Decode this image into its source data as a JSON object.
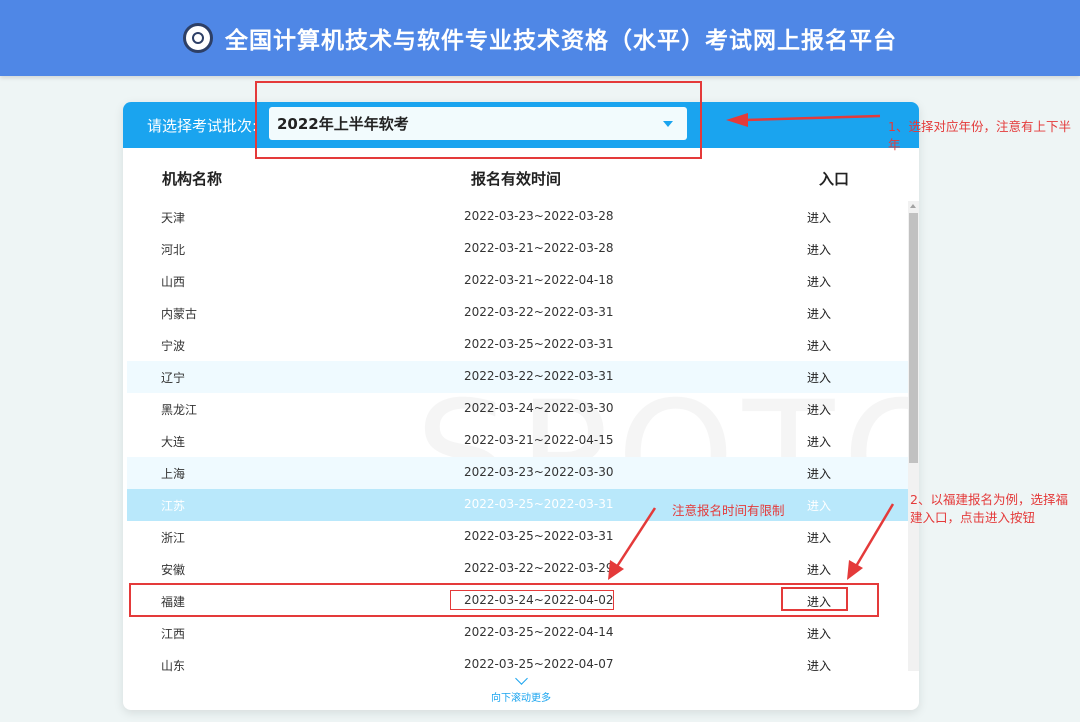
{
  "header": {
    "title": "全国计算机技术与软件专业技术资格（水平）考试网上报名平台"
  },
  "batch": {
    "label": "请选择考试批次:",
    "selected": "2022年上半年软考"
  },
  "table": {
    "columns": [
      "机构名称",
      "报名有效时间",
      "入口"
    ],
    "rows": [
      {
        "name": "天津",
        "time": "2022-03-23~2022-03-28",
        "action": "进入"
      },
      {
        "name": "河北",
        "time": "2022-03-21~2022-03-28",
        "action": "进入"
      },
      {
        "name": "山西",
        "time": "2022-03-21~2022-04-18",
        "action": "进入"
      },
      {
        "name": "内蒙古",
        "time": "2022-03-22~2022-03-31",
        "action": "进入"
      },
      {
        "name": "宁波",
        "time": "2022-03-25~2022-03-31",
        "action": "进入"
      },
      {
        "name": "辽宁",
        "time": "2022-03-22~2022-03-31",
        "action": "进入"
      },
      {
        "name": "黑龙江",
        "time": "2022-03-24~2022-03-30",
        "action": "进入"
      },
      {
        "name": "大连",
        "time": "2022-03-21~2022-04-15",
        "action": "进入"
      },
      {
        "name": "上海",
        "time": "2022-03-23~2022-03-30",
        "action": "进入"
      },
      {
        "name": "江苏",
        "time": "2022-03-25~2022-03-31",
        "action": "进入"
      },
      {
        "name": "浙江",
        "time": "2022-03-25~2022-03-31",
        "action": "进入"
      },
      {
        "name": "安徽",
        "time": "2022-03-22~2022-03-29",
        "action": "进入"
      },
      {
        "name": "福建",
        "time": "2022-03-24~2022-04-02",
        "action": "进入"
      },
      {
        "name": "江西",
        "time": "2022-03-25~2022-04-14",
        "action": "进入"
      },
      {
        "name": "山东",
        "time": "2022-03-25~2022-04-07",
        "action": "进入"
      }
    ]
  },
  "scroll_more": {
    "label": "向下滚动更多",
    "icon": "chevron-down-icon"
  },
  "watermark": "SPOTO",
  "annotations": {
    "note1": "1、选择对应年份，注意有上下半年",
    "note2": "2、以福建报名为例，选择福建入口，点击进入按钮",
    "note3": "注意报名时间有限制"
  },
  "colors": {
    "header": "#4f87e6",
    "accent": "#1aa4ef",
    "annotation": "#e43a3a"
  }
}
